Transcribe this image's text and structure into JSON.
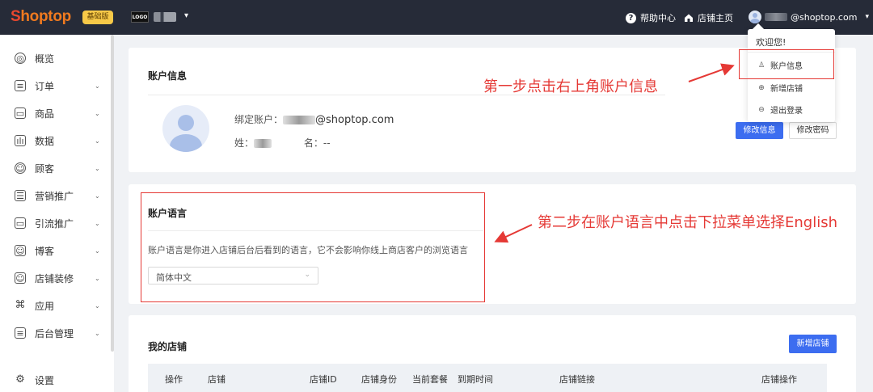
{
  "topbar": {
    "logo_first": "S",
    "logo_rest": "hoptop",
    "edition_badge": "基础版",
    "store_logo": "LOGO",
    "store_caret": "▾",
    "help_icon": "?",
    "help_label": "帮助中心",
    "home_label": "店铺主页",
    "user_email": "@shoptop.com",
    "user_caret": "▾"
  },
  "sidebar": {
    "items": [
      {
        "label": "概览",
        "icon": "compass-icon",
        "glyph": "◎",
        "has_chevron": false
      },
      {
        "label": "订单",
        "icon": "order-icon",
        "glyph": "≡",
        "has_chevron": true
      },
      {
        "label": "商品",
        "icon": "product-icon",
        "glyph": "▭",
        "has_chevron": true
      },
      {
        "label": "数据",
        "icon": "chart-icon",
        "glyph": "ılı",
        "has_chevron": true
      },
      {
        "label": "顾客",
        "icon": "customer-icon",
        "glyph": "☺",
        "has_chevron": true
      },
      {
        "label": "营销推广",
        "icon": "marketing-icon",
        "glyph": "☰",
        "has_chevron": true
      },
      {
        "label": "引流推广",
        "icon": "traffic-icon",
        "glyph": "▭",
        "has_chevron": true
      },
      {
        "label": "博客",
        "icon": "blog-icon",
        "glyph": "☺",
        "has_chevron": true
      },
      {
        "label": "店铺装修",
        "icon": "decoration-icon",
        "glyph": "☺",
        "has_chevron": true
      },
      {
        "label": "应用",
        "icon": "apps-icon",
        "glyph": "⌘",
        "has_chevron": true
      },
      {
        "label": "后台管理",
        "icon": "admin-icon",
        "glyph": "≡",
        "has_chevron": true
      }
    ],
    "chevron": "⌄",
    "settings_label": "设置",
    "settings_glyph": "⚙"
  },
  "account": {
    "title": "账户信息",
    "bound_label": "绑定账户：",
    "email": "@shoptop.com",
    "surname_label": "姓：",
    "given_label": "名：",
    "given_value": "--",
    "edit_button": "修改信息",
    "password_button": "修改密码"
  },
  "language": {
    "title": "账户语言",
    "description": "账户语言是你进入店铺后台后看到的语言，它不会影响你线上商店客户的浏览语言",
    "selected": "简体中文",
    "arrow": "⌄"
  },
  "stores": {
    "title": "我的店铺",
    "add_button": "新增店铺",
    "columns": [
      "操作",
      "店铺",
      "店铺ID",
      "店铺身份",
      "当前套餐",
      "到期时间",
      "店铺链接",
      "店铺操作"
    ]
  },
  "dropdown": {
    "welcome": "欢迎您!",
    "items": [
      {
        "label": "账户信息",
        "icon": "user-icon",
        "glyph": "♙"
      },
      {
        "label": "新增店铺",
        "icon": "add-circle-icon",
        "glyph": "⊕"
      },
      {
        "label": "退出登录",
        "icon": "logout-icon",
        "glyph": "⊖"
      }
    ]
  },
  "annotations": {
    "step1": "第一步点击右上角账户信息",
    "step2": "第二步在账户语言中点击下拉菜单选择English",
    "color": "#e53935"
  }
}
